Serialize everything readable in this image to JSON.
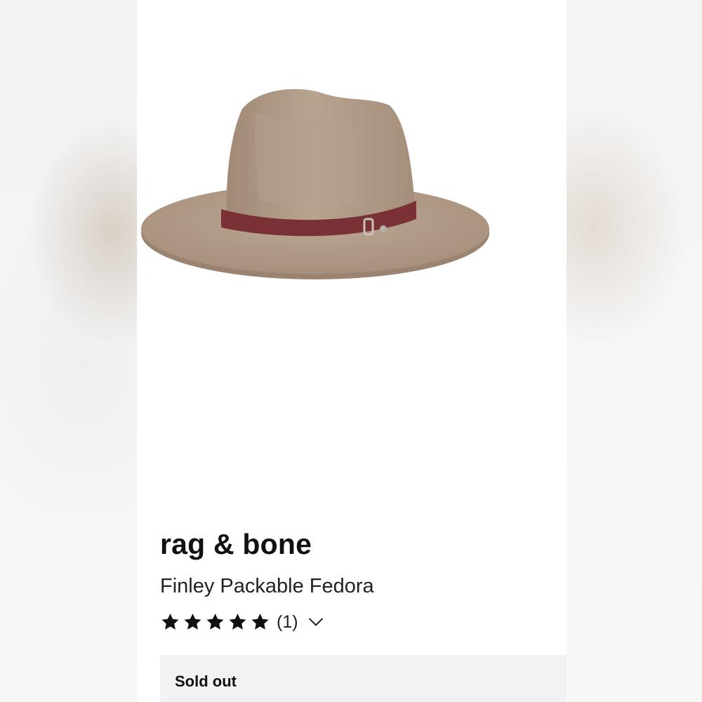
{
  "product": {
    "brand": "rag & bone",
    "name": "Finley Packable Fedora",
    "image_icon": "fedora-hat-image"
  },
  "rating": {
    "stars": 5,
    "max_stars": 5,
    "count_label": "(1)",
    "expand_icon": "chevron-down-icon"
  },
  "availability": {
    "status": "Sold out"
  },
  "colors": {
    "hat_felt": "#b09a86",
    "hat_band": "#7a3135",
    "status_bg": "#f1f2f3",
    "text": "#111111"
  }
}
